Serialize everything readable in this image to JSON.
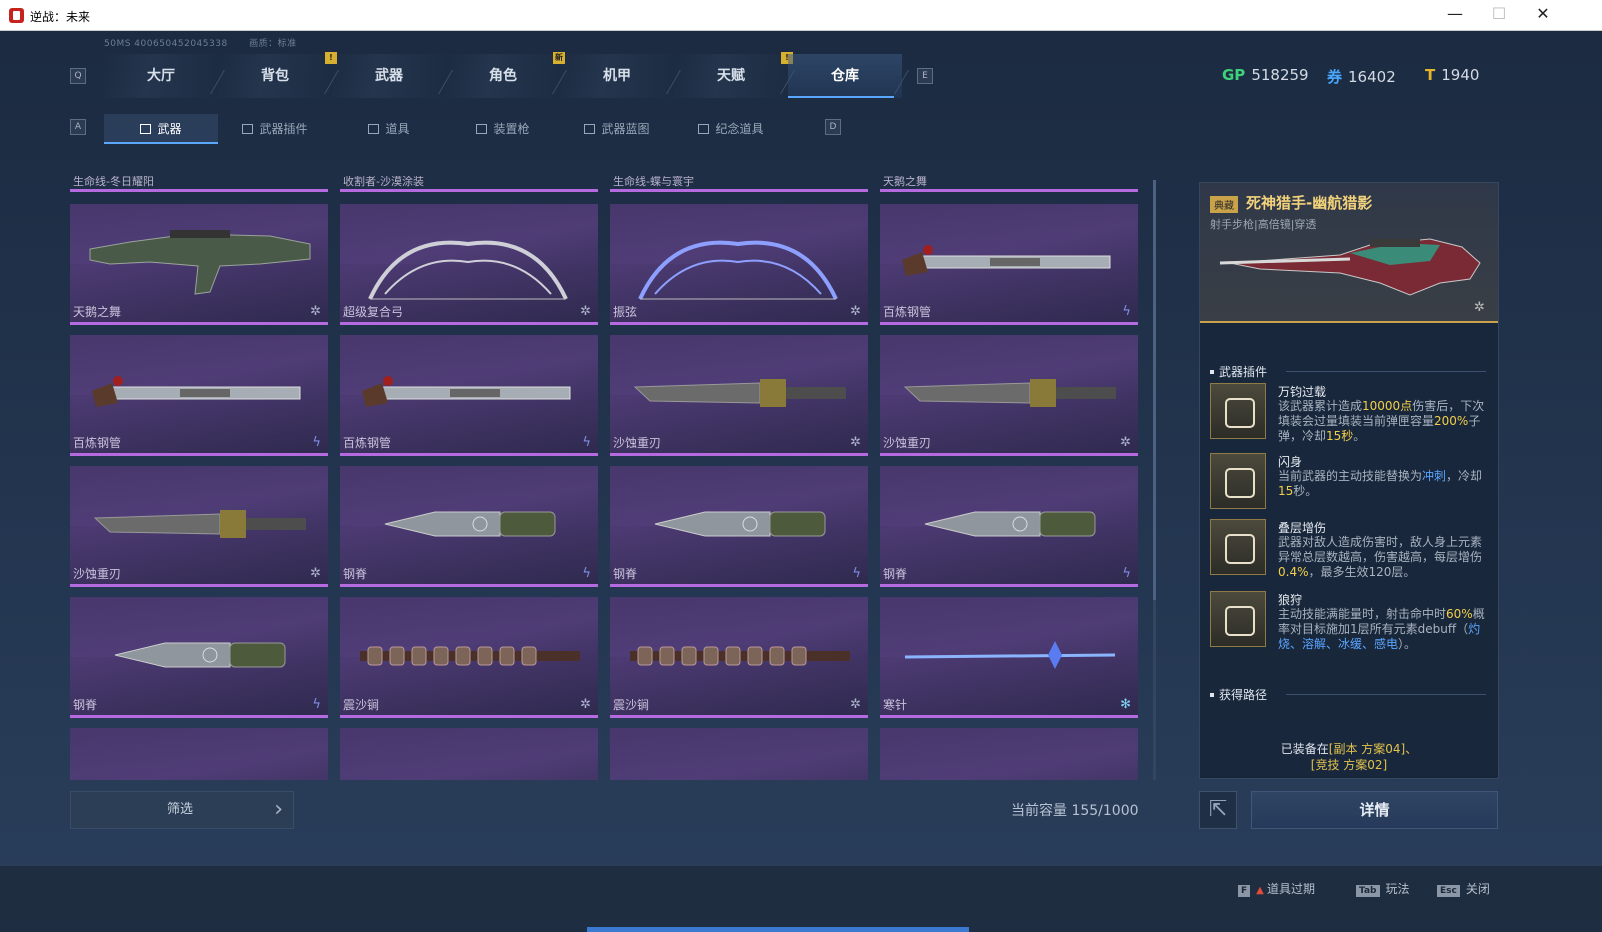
{
  "window": {
    "title": "逆战：未来",
    "min": "—",
    "max": "☐",
    "close": "✕"
  },
  "info": {
    "left": "50MS   400650452045338",
    "right": "画质：标准"
  },
  "keys": {
    "q": "Q",
    "e": "E",
    "a": "A",
    "d": "D"
  },
  "tabs": [
    {
      "label": "大厅",
      "badge": ""
    },
    {
      "label": "背包",
      "badge": "!"
    },
    {
      "label": "武器",
      "badge": ""
    },
    {
      "label": "角色",
      "badge": "新"
    },
    {
      "label": "机甲",
      "badge": ""
    },
    {
      "label": "天赋",
      "badge": "!"
    },
    {
      "label": "仓库",
      "badge": "",
      "active": true
    }
  ],
  "currency": [
    {
      "icon": "GP",
      "value": "518259",
      "color": "#3fd07a"
    },
    {
      "icon": "券",
      "value": "16402",
      "color": "#4aa6ff"
    },
    {
      "icon": "T",
      "value": "1940",
      "color": "#e2b52a"
    }
  ],
  "subtabs": [
    {
      "label": "武器",
      "active": true
    },
    {
      "label": "武器插件"
    },
    {
      "label": "道具"
    },
    {
      "label": "装置枪"
    },
    {
      "label": "武器蓝图"
    },
    {
      "label": "纪念道具"
    }
  ],
  "top_headers": [
    "生命线-冬日耀阳",
    "收割者-沙漠涂装",
    "生命线-蝶与寰宇",
    "天鹅之舞"
  ],
  "cards": [
    {
      "name": "天鹅之舞",
      "type": "✲",
      "icon": "rifle"
    },
    {
      "name": "超级复合弓",
      "type": "✲",
      "icon": "bow"
    },
    {
      "name": "振弦",
      "type": "✲",
      "icon": "bow2"
    },
    {
      "name": "百炼钢管",
      "type": "ϟ",
      "icon": "pipe"
    },
    {
      "name": "百炼钢管",
      "type": "ϟ",
      "icon": "pipe"
    },
    {
      "name": "百炼钢管",
      "type": "ϟ",
      "icon": "pipe"
    },
    {
      "name": "沙蚀重刃",
      "type": "✲",
      "icon": "blade"
    },
    {
      "name": "沙蚀重刃",
      "type": "✲",
      "icon": "blade"
    },
    {
      "name": "沙蚀重刃",
      "type": "✲",
      "icon": "blade"
    },
    {
      "name": "钢脊",
      "type": "ϟ",
      "icon": "knife"
    },
    {
      "name": "钢脊",
      "type": "ϟ",
      "icon": "knife"
    },
    {
      "name": "钢脊",
      "type": "ϟ",
      "icon": "knife"
    },
    {
      "name": "钢脊",
      "type": "ϟ",
      "icon": "knife"
    },
    {
      "name": "震沙锏",
      "type": "✲",
      "icon": "mace"
    },
    {
      "name": "震沙锏",
      "type": "✲",
      "icon": "mace"
    },
    {
      "name": "寒针",
      "type": "✻",
      "icon": "needle"
    }
  ],
  "filter": {
    "label": "筛选",
    "chev": "›"
  },
  "capacity": "当前容量 155/1000",
  "detail": {
    "tag": "典藏",
    "name": "死神猎手-幽航猎影",
    "sub": "射手步枪|高倍镜|穿透",
    "plugins_title": "武器插件",
    "plugins": [
      {
        "name": "万钧过载",
        "desc": [
          "该武器累计造成",
          "10000点",
          "伤害后，下次填装会过量填装当前弹匣容量",
          "200%",
          "子弹，冷却",
          "15秒",
          "。"
        ]
      },
      {
        "name": "闪身",
        "desc": [
          "当前武器的主动技能替换为",
          "冲刺",
          "，冷却",
          "15",
          "秒。"
        ]
      },
      {
        "name": "叠层增伤",
        "desc": [
          "武器对敌人造成伤害时，敌人身上元素异常总层数越高，伤害越高，每层增伤",
          "0.4%",
          "，最多生效120层。"
        ]
      },
      {
        "name": "狼狩",
        "desc": [
          "主动技能满能量时，射击命中时",
          "60%",
          "概率对目标施加1层所有元素debuff（",
          "灼烧、溶解、冰缓、感电",
          "）。"
        ]
      }
    ],
    "source_title": "获得路径",
    "equipped": [
      "已装备在",
      "[副本 方案04]、",
      "[竞技 方案02]"
    ]
  },
  "detail_button": "详情",
  "hints": [
    {
      "key": "F",
      "label": "道具过期"
    },
    {
      "key": "Tab",
      "label": "玩法"
    },
    {
      "key": "Esc",
      "label": "关闭"
    }
  ]
}
